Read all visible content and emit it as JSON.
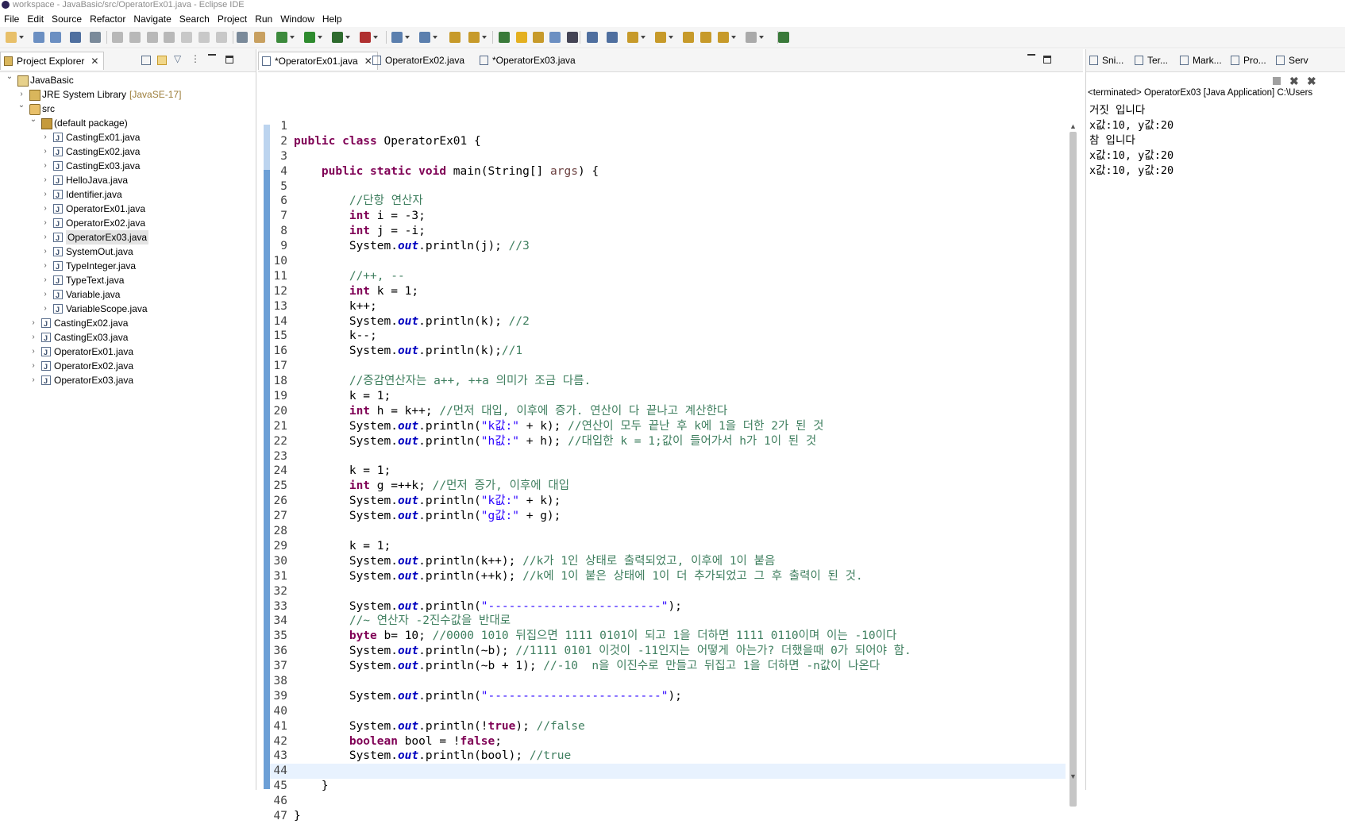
{
  "window": {
    "title": "workspace - JavaBasic/src/OperatorEx01.java - Eclipse IDE"
  },
  "menu": [
    "File",
    "Edit",
    "Source",
    "Refactor",
    "Navigate",
    "Search",
    "Project",
    "Run",
    "Window",
    "Help"
  ],
  "explorer": {
    "tab_label": "Project Explorer",
    "tree": [
      {
        "label": "JavaBasic",
        "depth": 0,
        "expanded": true,
        "icon": "project-icon"
      },
      {
        "label": "JRE System Library",
        "suffix": "[JavaSE-17]",
        "depth": 1,
        "expanded": false,
        "icon": "library-icon"
      },
      {
        "label": "src",
        "depth": 1,
        "expanded": true,
        "icon": "source-folder-icon"
      },
      {
        "label": "(default package)",
        "depth": 2,
        "expanded": true,
        "icon": "package-icon"
      },
      {
        "label": "CastingEx01.java",
        "depth": 3,
        "icon": "java-file-icon"
      },
      {
        "label": "CastingEx02.java",
        "depth": 3,
        "icon": "java-file-icon"
      },
      {
        "label": "CastingEx03.java",
        "depth": 3,
        "icon": "java-file-icon"
      },
      {
        "label": "HelloJava.java",
        "depth": 3,
        "icon": "java-file-icon"
      },
      {
        "label": "Identifier.java",
        "depth": 3,
        "icon": "java-file-icon"
      },
      {
        "label": "OperatorEx01.java",
        "depth": 3,
        "icon": "java-file-icon"
      },
      {
        "label": "OperatorEx02.java",
        "depth": 3,
        "icon": "java-file-icon"
      },
      {
        "label": "OperatorEx03.java",
        "depth": 3,
        "icon": "java-file-icon",
        "selected": true
      },
      {
        "label": "SystemOut.java",
        "depth": 3,
        "icon": "java-file-icon"
      },
      {
        "label": "TypeInteger.java",
        "depth": 3,
        "icon": "java-file-icon"
      },
      {
        "label": "TypeText.java",
        "depth": 3,
        "icon": "java-file-icon"
      },
      {
        "label": "Variable.java",
        "depth": 3,
        "icon": "java-file-icon"
      },
      {
        "label": "VariableScope.java",
        "depth": 3,
        "icon": "java-file-icon"
      },
      {
        "label": "CastingEx02.java",
        "depth": 2,
        "icon": "java-file-icon"
      },
      {
        "label": "CastingEx03.java",
        "depth": 2,
        "icon": "java-file-icon"
      },
      {
        "label": "OperatorEx01.java",
        "depth": 2,
        "icon": "java-file-icon"
      },
      {
        "label": "OperatorEx02.java",
        "depth": 2,
        "icon": "java-file-icon"
      },
      {
        "label": "OperatorEx03.java",
        "depth": 2,
        "icon": "java-file-icon"
      }
    ]
  },
  "editor": {
    "tabs": [
      {
        "label": "*OperatorEx01.java",
        "active": true
      },
      {
        "label": "OperatorEx02.java",
        "active": false
      },
      {
        "label": "*OperatorEx03.java",
        "active": false
      }
    ],
    "current_line": 44,
    "lines": [
      [],
      [
        [
          "kw",
          "public class "
        ],
        [
          "p",
          "OperatorEx01 {"
        ]
      ],
      [],
      [
        [
          "p",
          "    "
        ],
        [
          "kw",
          "public static void "
        ],
        [
          "p",
          "main(String[] "
        ],
        [
          "vr",
          "args"
        ],
        [
          "p",
          ") {"
        ]
      ],
      [],
      [
        [
          "p",
          "        "
        ],
        [
          "cm",
          "//단항 연산자"
        ]
      ],
      [
        [
          "p",
          "        "
        ],
        [
          "kw",
          "int "
        ],
        [
          "p",
          "i = -3;"
        ]
      ],
      [
        [
          "p",
          "        "
        ],
        [
          "kw",
          "int "
        ],
        [
          "p",
          "j = -i;"
        ]
      ],
      [
        [
          "p",
          "        System."
        ],
        [
          "fd",
          "out"
        ],
        [
          "p",
          ".println(j); "
        ],
        [
          "cm",
          "//3"
        ]
      ],
      [],
      [
        [
          "p",
          "        "
        ],
        [
          "cm",
          "//++, --"
        ]
      ],
      [
        [
          "p",
          "        "
        ],
        [
          "kw",
          "int "
        ],
        [
          "p",
          "k = 1;"
        ]
      ],
      [
        [
          "p",
          "        k++;"
        ]
      ],
      [
        [
          "p",
          "        System."
        ],
        [
          "fd",
          "out"
        ],
        [
          "p",
          ".println(k); "
        ],
        [
          "cm",
          "//2"
        ]
      ],
      [
        [
          "p",
          "        k--;"
        ]
      ],
      [
        [
          "p",
          "        System."
        ],
        [
          "fd",
          "out"
        ],
        [
          "p",
          ".println(k);"
        ],
        [
          "cm",
          "//1"
        ]
      ],
      [],
      [
        [
          "p",
          "        "
        ],
        [
          "cm",
          "//증감연산자는 a++, ++a 의미가 조금 다름."
        ]
      ],
      [
        [
          "p",
          "        k = 1;"
        ]
      ],
      [
        [
          "p",
          "        "
        ],
        [
          "kw",
          "int "
        ],
        [
          "p",
          "h = k++; "
        ],
        [
          "cm",
          "//먼저 대입, 이후에 증가. 연산이 다 끝나고 계산한다"
        ]
      ],
      [
        [
          "p",
          "        System."
        ],
        [
          "fd",
          "out"
        ],
        [
          "p",
          ".println("
        ],
        [
          "st",
          "\"k값:\""
        ],
        [
          "p",
          " + k); "
        ],
        [
          "cm",
          "//연산이 모두 끝난 후 k에 1을 더한 2가 된 것"
        ]
      ],
      [
        [
          "p",
          "        System."
        ],
        [
          "fd",
          "out"
        ],
        [
          "p",
          ".println("
        ],
        [
          "st",
          "\"h값:\""
        ],
        [
          "p",
          " + h); "
        ],
        [
          "cm",
          "//대입한 k = 1;값이 들어가서 h가 1이 된 것"
        ]
      ],
      [],
      [
        [
          "p",
          "        k = 1;"
        ]
      ],
      [
        [
          "p",
          "        "
        ],
        [
          "kw",
          "int "
        ],
        [
          "p",
          "g =++k; "
        ],
        [
          "cm",
          "//먼저 증가, 이후에 대입"
        ]
      ],
      [
        [
          "p",
          "        System."
        ],
        [
          "fd",
          "out"
        ],
        [
          "p",
          ".println("
        ],
        [
          "st",
          "\"k값:\""
        ],
        [
          "p",
          " + k);"
        ]
      ],
      [
        [
          "p",
          "        System."
        ],
        [
          "fd",
          "out"
        ],
        [
          "p",
          ".println("
        ],
        [
          "st",
          "\"g값:\""
        ],
        [
          "p",
          " + g);"
        ]
      ],
      [],
      [
        [
          "p",
          "        k = 1;"
        ]
      ],
      [
        [
          "p",
          "        System."
        ],
        [
          "fd",
          "out"
        ],
        [
          "p",
          ".println(k++); "
        ],
        [
          "cm",
          "//k가 1인 상태로 출력되었고, 이후에 1이 붙음"
        ]
      ],
      [
        [
          "p",
          "        System."
        ],
        [
          "fd",
          "out"
        ],
        [
          "p",
          ".println(++k); "
        ],
        [
          "cm",
          "//k에 1이 붙은 상태에 1이 더 추가되었고 그 후 출력이 된 것."
        ]
      ],
      [],
      [
        [
          "p",
          "        System."
        ],
        [
          "fd",
          "out"
        ],
        [
          "p",
          ".println("
        ],
        [
          "st",
          "\"-------------------------\""
        ],
        [
          "p",
          ");"
        ]
      ],
      [
        [
          "p",
          "        "
        ],
        [
          "cm",
          "//~ 연산자 -2진수값을 반대로"
        ]
      ],
      [
        [
          "p",
          "        "
        ],
        [
          "kw",
          "byte "
        ],
        [
          "p",
          "b= 10; "
        ],
        [
          "cm",
          "//0000 1010 뒤집으면 1111 0101이 되고 1을 더하면 1111 0110이며 이는 -10이다"
        ]
      ],
      [
        [
          "p",
          "        System."
        ],
        [
          "fd",
          "out"
        ],
        [
          "p",
          ".println(~b); "
        ],
        [
          "cm",
          "//1111 0101 이것이 -11인지는 어떻게 아는가? 더했을때 0가 되어야 함."
        ]
      ],
      [
        [
          "p",
          "        System."
        ],
        [
          "fd",
          "out"
        ],
        [
          "p",
          ".println(~b + 1); "
        ],
        [
          "cm",
          "//-10  n을 이진수로 만들고 뒤집고 1을 더하면 -n값이 나온다"
        ]
      ],
      [],
      [
        [
          "p",
          "        System."
        ],
        [
          "fd",
          "out"
        ],
        [
          "p",
          ".println("
        ],
        [
          "st",
          "\"-------------------------\""
        ],
        [
          "p",
          ");"
        ]
      ],
      [],
      [
        [
          "p",
          "        System."
        ],
        [
          "fd",
          "out"
        ],
        [
          "p",
          ".println(!"
        ],
        [
          "kw",
          "true"
        ],
        [
          "p",
          "); "
        ],
        [
          "cm",
          "//false"
        ]
      ],
      [
        [
          "p",
          "        "
        ],
        [
          "kw",
          "boolean "
        ],
        [
          "p",
          "bool = !"
        ],
        [
          "kw",
          "false"
        ],
        [
          "p",
          ";"
        ]
      ],
      [
        [
          "p",
          "        System."
        ],
        [
          "fd",
          "out"
        ],
        [
          "p",
          ".println(bool); "
        ],
        [
          "cm",
          "//true"
        ]
      ],
      [],
      [
        [
          "p",
          "    }"
        ]
      ],
      [],
      [
        [
          "p",
          "}"
        ]
      ]
    ]
  },
  "console": {
    "tabs": [
      "Sni...",
      "Ter...",
      "Mark...",
      "Pro...",
      "Serv"
    ],
    "header": "<terminated> OperatorEx03 [Java Application] C:\\Users",
    "output": [
      "거짓 입니다",
      "x값:10, y값:20",
      "참 입니다",
      "x값:10, y값:20",
      "x값:10, y값:20"
    ]
  }
}
